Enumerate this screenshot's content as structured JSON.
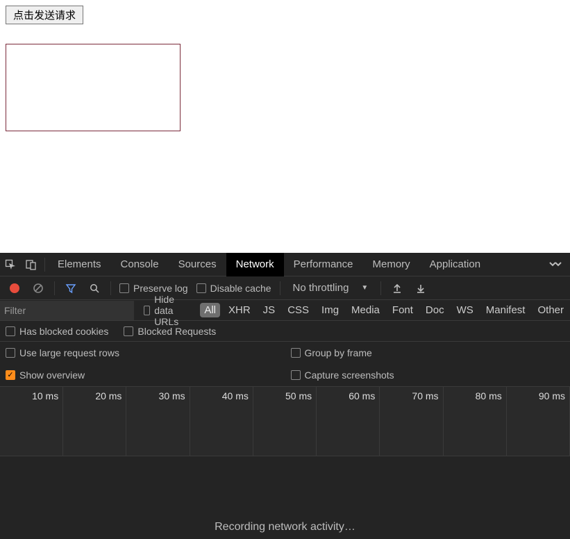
{
  "page": {
    "send_button": "点击发送请求"
  },
  "devtools": {
    "tabs": [
      "Elements",
      "Console",
      "Sources",
      "Network",
      "Performance",
      "Memory",
      "Application"
    ],
    "active_tab": "Network",
    "toolbar": {
      "preserve_log": "Preserve log",
      "disable_cache": "Disable cache",
      "throttling": "No throttling"
    },
    "filter": {
      "placeholder": "Filter",
      "hide_data_urls": "Hide data URLs",
      "types": [
        "All",
        "XHR",
        "JS",
        "CSS",
        "Img",
        "Media",
        "Font",
        "Doc",
        "WS",
        "Manifest",
        "Other"
      ],
      "active_type": "All"
    },
    "cookies_row": {
      "has_blocked_cookies": "Has blocked cookies",
      "blocked_requests": "Blocked Requests"
    },
    "options": {
      "use_large_rows": "Use large request rows",
      "group_by_frame": "Group by frame",
      "show_overview": "Show overview",
      "capture_screenshots": "Capture screenshots"
    },
    "timeline": {
      "ticks": [
        "10 ms",
        "20 ms",
        "30 ms",
        "40 ms",
        "50 ms",
        "60 ms",
        "70 ms",
        "80 ms",
        "90 ms"
      ]
    },
    "status": "Recording network activity…"
  }
}
